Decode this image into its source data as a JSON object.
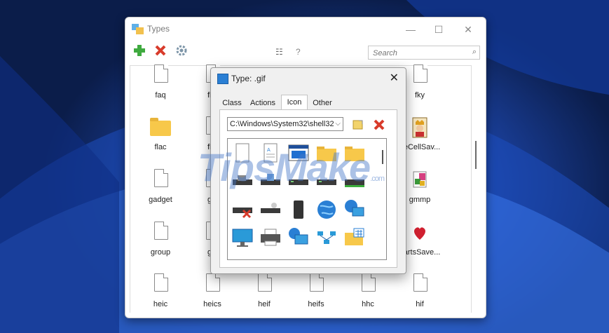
{
  "window": {
    "title": "Types",
    "minimize_glyph": "—",
    "maximize_glyph": "☐",
    "close_glyph": "✕"
  },
  "toolbar": {
    "add_icon": "plus-icon",
    "delete_icon": "x-icon",
    "settings_icon": "gear-icon",
    "view_glyph": "☷",
    "help_glyph": "?",
    "search_placeholder": "Search"
  },
  "types_grid": {
    "labels": [
      "faq",
      "fky",
      "flac",
      "eeCellSav...",
      "gadget",
      "gmmp",
      "group",
      "eartsSave...",
      "heic",
      "heics",
      "heif",
      "heifs",
      "hhc",
      "hif"
    ],
    "partial_col_letters": [
      "fl",
      "fl",
      "g",
      "g"
    ]
  },
  "dialog": {
    "title": "Type: .gif",
    "close_glyph": "✕",
    "tabs": [
      "Class",
      "Actions",
      "Icon",
      "Other"
    ],
    "active_tab": "Icon",
    "icon_path": "C:\\Windows\\System32\\shell32",
    "dropdown_glyph": "⌵"
  },
  "watermark": {
    "text": "TipsMake",
    "suffix": ".com"
  },
  "colors": {
    "accent_blue": "#2a7fd4",
    "folder_yellow": "#f7c84a",
    "delete_red": "#d83b2b",
    "add_green": "#3faa3f"
  }
}
